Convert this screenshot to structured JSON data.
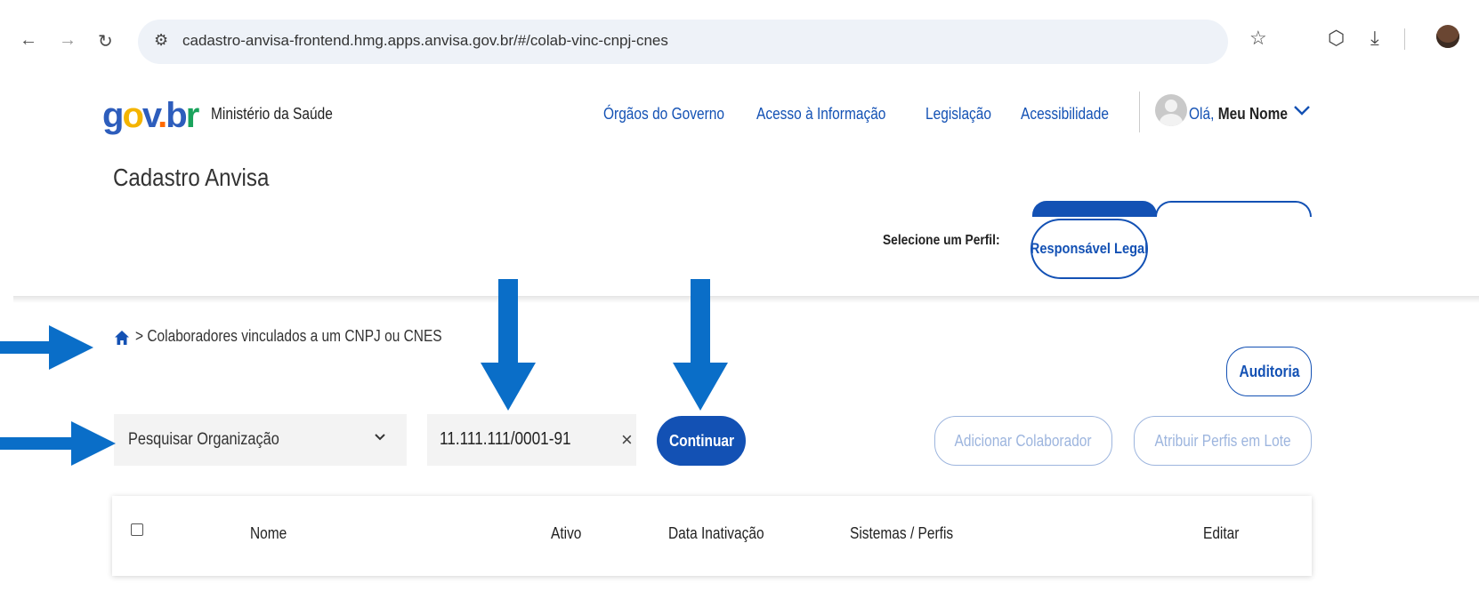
{
  "browser": {
    "url": "cadastro-anvisa-frontend.hmg.apps.anvisa.gov.br/#/colab-vinc-cnpj-cnes"
  },
  "header": {
    "logo": {
      "g": "g",
      "o": "o",
      "v": "v",
      "dot": ".",
      "b": "b",
      "r": "r"
    },
    "ministry": "Ministério da Saúde",
    "links": [
      "Órgãos do Governo",
      "Acesso à Informação",
      "Legislação",
      "Acessibilidade"
    ],
    "greeting_prefix": "Olá,",
    "user_name": "Meu Nome",
    "app_title": "Cadastro Anvisa",
    "profile_label": "Selecione um Perfil:",
    "profile_selected": "Responsável Legal"
  },
  "breadcrumb": {
    "separator": ">",
    "current": "Colaboradores vinculados a um CNPJ ou CNES"
  },
  "actions": {
    "audit": "Auditoria",
    "search_select": "Pesquisar Organização",
    "search_value": "11.111.111/0001-91",
    "continue": "Continuar",
    "add_collaborator": "Adicionar Colaborador",
    "assign_profiles": "Atribuir Perfis em Lote"
  },
  "table": {
    "columns": [
      "Nome",
      "Ativo",
      "Data Inativação",
      "Sistemas / Perfis",
      "Editar"
    ]
  },
  "colors": {
    "primary": "#1351b4",
    "arrow": "#0a6ec8"
  }
}
